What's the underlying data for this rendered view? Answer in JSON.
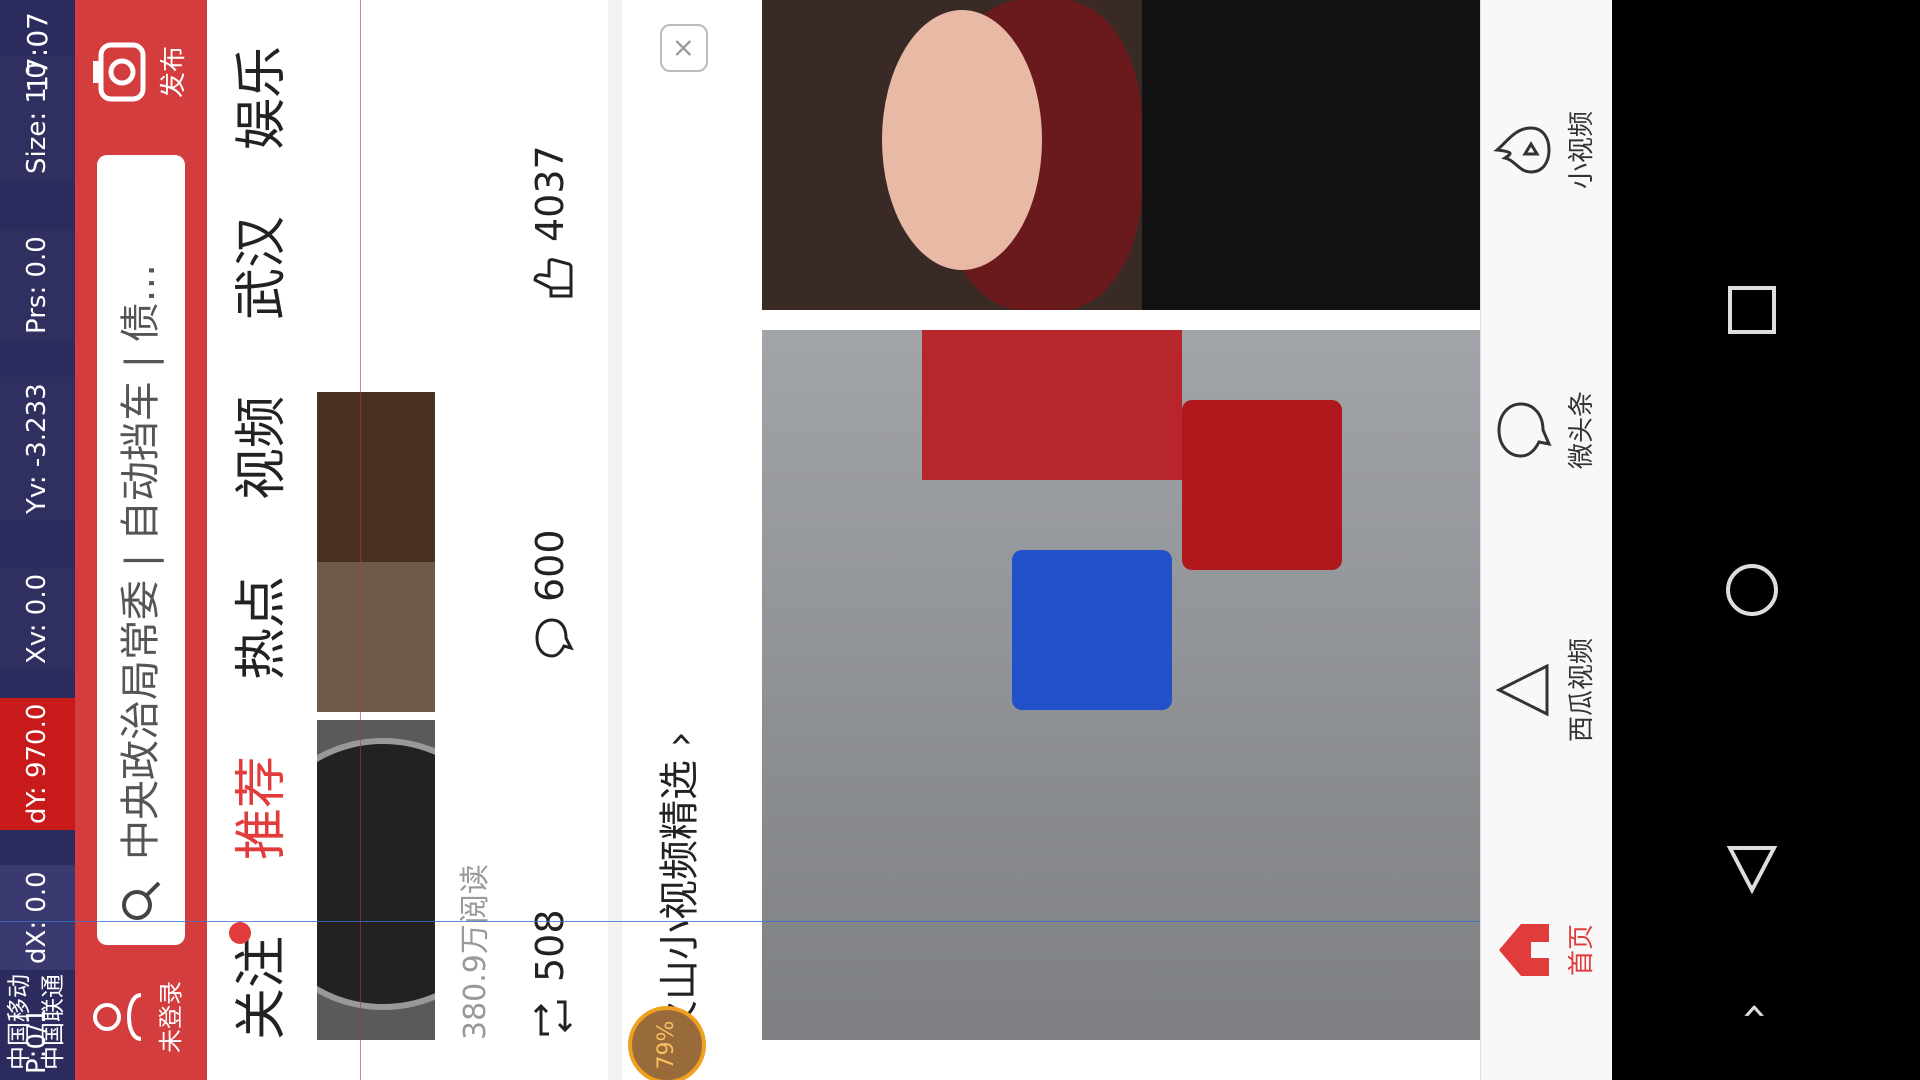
{
  "status_bar": {
    "carrier_1": "中国移动",
    "carrier_2": "中国联通",
    "debug": [
      "P:0/1",
      "dX: 0.0",
      "dY: 970.0",
      "Xv: 0.0",
      "Yv: -3.233",
      "Prs: 0.0",
      "Size: 1.0"
    ],
    "time": "17:07"
  },
  "header": {
    "login_label": "未登录",
    "search_text": "中央政治局常委 | 自动挡车 | 债...",
    "publish_label": "发布"
  },
  "tabs": [
    {
      "label": "关注",
      "active": false,
      "dot": true
    },
    {
      "label": "推荐",
      "active": true
    },
    {
      "label": "热点",
      "active": false
    },
    {
      "label": "视频",
      "active": false
    },
    {
      "label": "武汉",
      "active": false
    },
    {
      "label": "娱乐",
      "active": false
    }
  ],
  "feed_item": {
    "reads": "380.9万阅读",
    "repost": "508",
    "comments": "600",
    "likes": "4037"
  },
  "video_section": {
    "title": "火山小视频精选 ›",
    "close": "×",
    "badge": "79%"
  },
  "bottom_nav": [
    {
      "label": "首页",
      "icon": "home-icon",
      "active": true
    },
    {
      "label": "西瓜视频",
      "icon": "play-triangle-icon",
      "active": false
    },
    {
      "label": "微头条",
      "icon": "chat-bubble-icon",
      "active": false
    },
    {
      "label": "小视频",
      "icon": "flame-icon",
      "active": false
    }
  ],
  "colors": {
    "accent": "#d43d3d",
    "active_tab": "#e23b3b"
  }
}
